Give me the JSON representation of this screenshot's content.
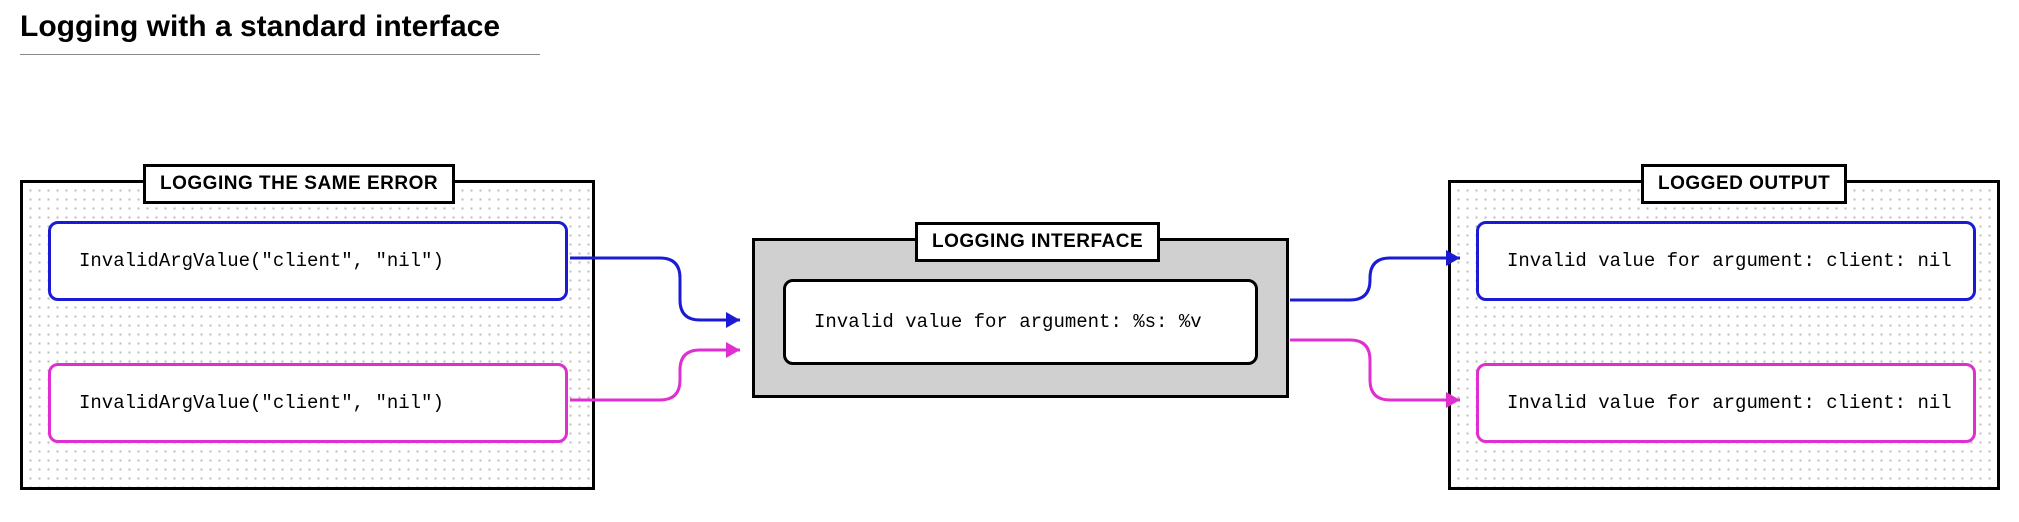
{
  "title": "Logging with a standard interface",
  "left_panel": {
    "label": "LOGGING THE SAME ERROR",
    "items": [
      "InvalidArgValue(\"client\", \"nil\")",
      "InvalidArgValue(\"client\", \"nil\")"
    ]
  },
  "center_panel": {
    "label": "LOGGING INTERFACE",
    "template": "Invalid value for argument: %s: %v"
  },
  "right_panel": {
    "label": "LOGGED OUTPUT",
    "items": [
      "Invalid value for argument: client: nil",
      "Invalid value for argument: client: nil"
    ]
  },
  "colors": {
    "blue": "#1b1bd6",
    "pink": "#e02fd0"
  }
}
